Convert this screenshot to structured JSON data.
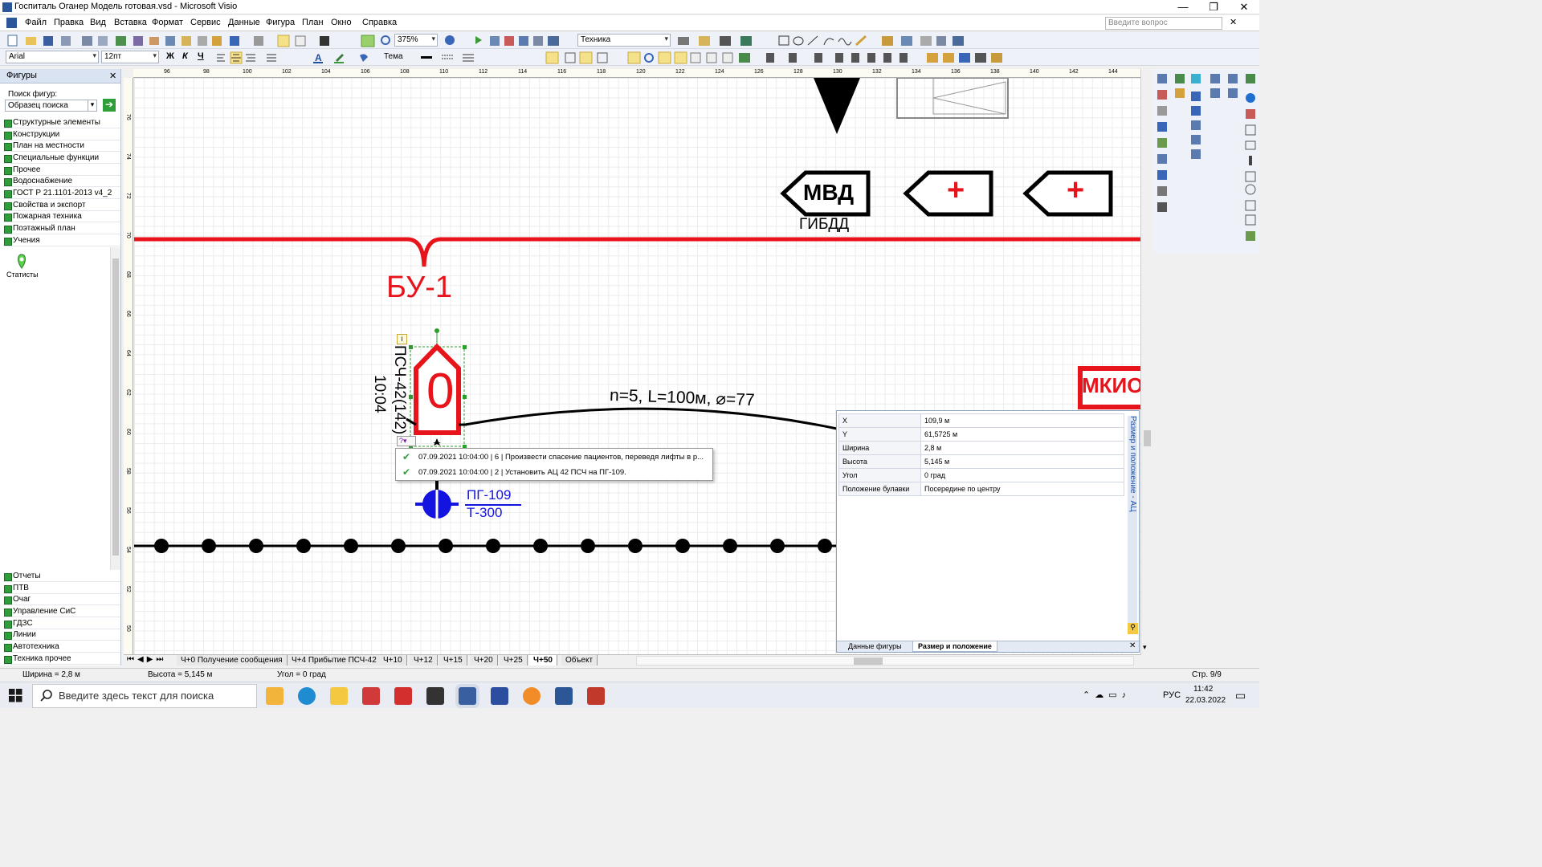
{
  "window": {
    "title": "Госпиталь Оганер Модель готовая.vsd - Microsoft Visio",
    "min": "—",
    "max": "❐",
    "close": "✕"
  },
  "menu": [
    "Файл",
    "Правка",
    "Вид",
    "Вставка",
    "Формат",
    "Сервис",
    "Данные",
    "Фигура",
    "План",
    "Окно",
    "Справка"
  ],
  "help_placeholder": "Введите вопрос",
  "toolbar": {
    "zoom": "375%",
    "style": "Техника",
    "font": "Arial",
    "size": "12пт",
    "theme": "Тема",
    "bold": "Ж",
    "italic": "К",
    "underline": "Ч"
  },
  "shapes_panel": {
    "title": "Фигуры",
    "search_label": "Поиск фигур:",
    "search_placeholder": "Образец поиска",
    "categories_top": [
      "Структурные элементы",
      "Конструкции",
      "План на местности",
      "Специальные функции",
      "Прочее",
      "Водоснабжение",
      "ГОСТ Р 21.1101-2013 v4_2",
      "Свойства и экспорт",
      "Пожарная техника",
      "Поэтажный план",
      "Учения"
    ],
    "stencil_item": "Статисты",
    "categories_bottom": [
      "Отчеты",
      "ПТВ",
      "Очаг",
      "Управление СиС",
      "ГДЗС",
      "Линии",
      "Автотехника",
      "Техника прочее"
    ]
  },
  "ruler_top": [
    "96",
    "98",
    "100",
    "102",
    "104",
    "106",
    "108",
    "110",
    "112",
    "114",
    "116",
    "118",
    "120",
    "122",
    "124",
    "126",
    "128",
    "130",
    "132",
    "134",
    "136",
    "138",
    "140",
    "142",
    "144"
  ],
  "ruler_left": [
    "76",
    "74",
    "72",
    "70",
    "68",
    "66",
    "64",
    "62",
    "60",
    "58",
    "56",
    "54",
    "52",
    "50"
  ],
  "drawing": {
    "tags": [
      "МВД",
      "+",
      "+"
    ],
    "gibdd": "ГИБДД",
    "bu": "БУ-1",
    "unit_label": "ПСЧ-42(142)",
    "unit_time": "10:04",
    "unit_letter": "0",
    "hose": "n=5, L=100м, ⌀=77",
    "hydrant_line1": "ПГ-109",
    "hydrant_line2": "Т-300",
    "mkio": "МКИО",
    "info_marker": "i",
    "help_marker": "?▾"
  },
  "popup": [
    "07.09.2021 10:04:00 | 6 | Произвести спасение пациентов, переведя лифты в р...",
    "07.09.2021 10:04:00 | 2 | Установить АЦ 42 ПСЧ на ПГ-109."
  ],
  "props": {
    "rows": [
      [
        "X",
        "109,9 м"
      ],
      [
        "Y",
        "61,5725 м"
      ],
      [
        "Ширина",
        "2,8 м"
      ],
      [
        "Высота",
        "5,145 м"
      ],
      [
        "Угол",
        "0 град"
      ],
      [
        "Положение булавки",
        "Посередине по центру"
      ]
    ],
    "vertical_title": "Размер и положение - АЦ",
    "tab1": "Данные фигуры",
    "tab2": "Размер и положение",
    "close": "✕"
  },
  "page_tabs": [
    "Ч+0 Получение сообщения",
    "Ч+4 Прибытие ПСЧ-42",
    "Ч+10",
    "Ч+12",
    "Ч+15",
    "Ч+20",
    "Ч+25",
    "Ч+50",
    "Объект"
  ],
  "status": {
    "width": "Ширина = 2,8 м",
    "height": "Высота = 5,145 м",
    "angle": "Угол = 0 град",
    "page": "Стр. 9/9"
  },
  "taskbar": {
    "search": "Введите здесь текст для поиска",
    "lang": "РУС",
    "time": "11:42",
    "date": "22.03.2022"
  },
  "colors": {
    "red": "#e8141b",
    "blue": "#1414e0",
    "grid": "#ececec"
  }
}
